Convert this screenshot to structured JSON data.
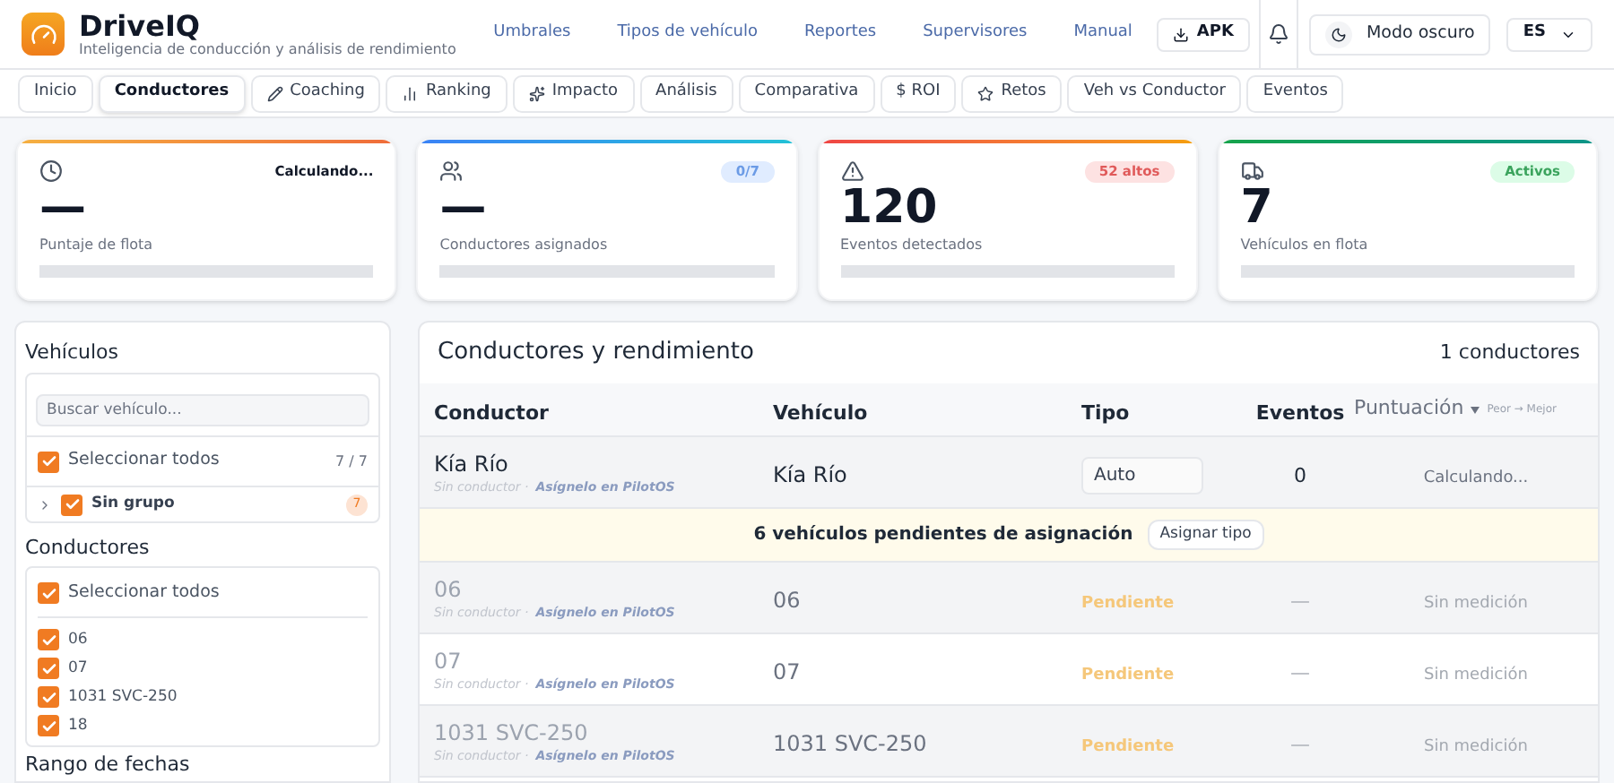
{
  "brand": {
    "name": "DriveIQ",
    "tagline": "Inteligencia de conducción y análisis de rendimiento"
  },
  "nav": [
    "Umbrales",
    "Tipos de vehículo",
    "Reportes",
    "Supervisores",
    "Manual"
  ],
  "apk_button": "APK",
  "dark_mode": {
    "label": "Modo oscuro",
    "on": false
  },
  "language": "ES",
  "tabs": [
    {
      "label": "Inicio",
      "selected": false
    },
    {
      "label": "Conductores",
      "selected": true
    },
    {
      "label": "Coaching",
      "selected": false
    },
    {
      "label": "Ranking",
      "selected": false
    },
    {
      "label": "Impacto",
      "selected": false
    },
    {
      "label": "Análisis",
      "selected": false
    },
    {
      "label": "Comparativa",
      "selected": false
    },
    {
      "label": "$ ROI",
      "selected": false
    },
    {
      "label": "Retos",
      "selected": false
    },
    {
      "label": "Veh vs Conductor",
      "selected": false
    },
    {
      "label": "Eventos",
      "selected": false
    }
  ],
  "stat_cards": [
    {
      "kind": "plain",
      "badge": "Calculando...",
      "value": "—",
      "label": "Puntaje de flota"
    },
    {
      "kind": "info",
      "badge": "0/7",
      "value": "—",
      "label": "Conductores asignados"
    },
    {
      "kind": "danger",
      "badge": "52 altos",
      "value": "120",
      "label": "Eventos detectados"
    },
    {
      "kind": "success",
      "badge": "Activos",
      "value": "7",
      "label": "Vehículos en flota"
    }
  ],
  "sidebar": {
    "vehicles_title": "Vehículos",
    "search": {
      "placeholder": "Buscar vehículo..."
    },
    "select_all": {
      "label": "Seleccionar todos",
      "checked": true,
      "count": "7 / 7"
    },
    "groups": [
      {
        "label": "Sin grupo",
        "checked": true,
        "expanded": false,
        "count": "7"
      }
    ],
    "drivers_title": "Conductores",
    "drivers_select_all": {
      "label": "Seleccionar todos",
      "checked": true
    },
    "drivers": [
      {
        "label": "06",
        "checked": true
      },
      {
        "label": "07",
        "checked": true
      },
      {
        "label": "1031 SVC-250",
        "checked": true
      },
      {
        "label": "18",
        "checked": true
      }
    ],
    "date_title": "Rango de fechas"
  },
  "table": {
    "title": "Conductores y rendimiento",
    "count": "1 conductores",
    "columns": [
      "Conductor",
      "Vehículo",
      "Tipo",
      "Eventos",
      "Puntuación"
    ],
    "sort_hint": "Peor → Mejor",
    "rows": [
      {
        "kind": "active",
        "driver": "Kía Río",
        "subtitle": "Sin conductor ·",
        "link": "Asígnelo en PilotOS",
        "vehicle": "Kía Río",
        "type": "Auto",
        "events": "0",
        "score": "Calculando..."
      }
    ],
    "banner": {
      "text": "6 vehículos pendientes de asignación",
      "button": "Asignar tipo"
    },
    "pending_rows": [
      {
        "kind": "pending",
        "driver": "06",
        "subtitle": "Sin conductor ·",
        "link": "Asígnelo en PilotOS",
        "vehicle": "06",
        "type": "Pendiente",
        "events": "—",
        "score": "Sin medición"
      },
      {
        "kind": "pending",
        "driver": "07",
        "subtitle": "Sin conductor ·",
        "link": "Asígnelo en PilotOS",
        "vehicle": "07",
        "type": "Pendiente",
        "events": "—",
        "score": "Sin medición"
      },
      {
        "kind": "pending",
        "driver": "1031 SVC-250",
        "subtitle": "Sin conductor ·",
        "link": "Asígnelo en PilotOS",
        "vehicle": "1031 SVC-250",
        "type": "Pendiente",
        "events": "—",
        "score": "Sin medición"
      }
    ]
  }
}
